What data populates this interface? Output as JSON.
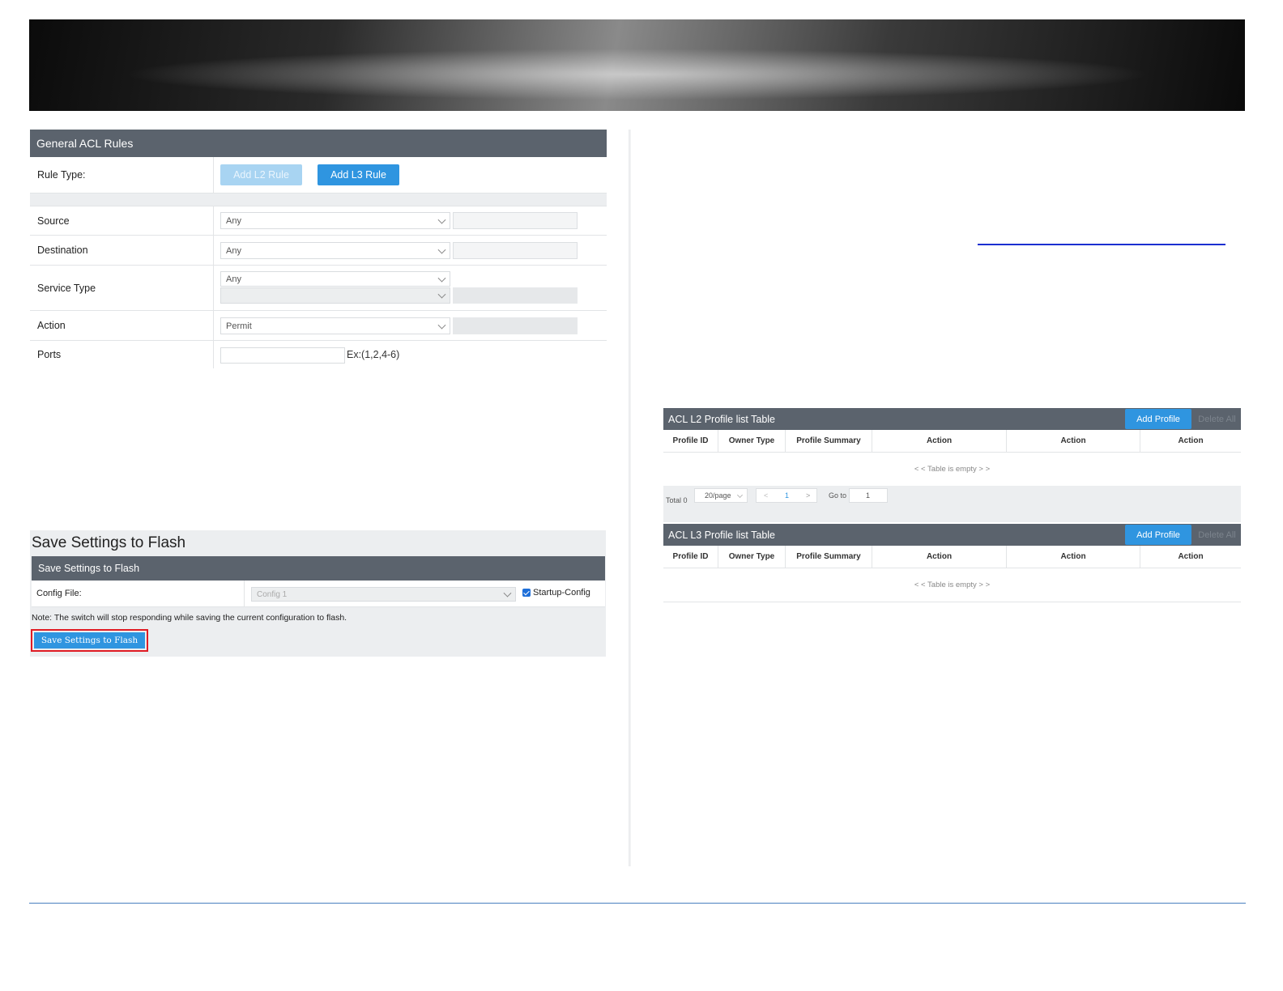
{
  "general_acl": {
    "title": "General ACL Rules",
    "rule_type_label": "Rule Type:",
    "add_l2_label": "Add L2 Rule",
    "add_l3_label": "Add L3 Rule",
    "source_label": "Source",
    "source_value": "Any",
    "destination_label": "Destination",
    "destination_value": "Any",
    "service_type_label": "Service Type",
    "service_type_value": "Any",
    "action_label": "Action",
    "action_value": "Permit",
    "ports_label": "Ports",
    "ports_value": "",
    "ports_hint": "Ex:(1,2,4-6)"
  },
  "save_settings": {
    "page_title": "Save Settings to Flash",
    "panel_title": "Save Settings to Flash",
    "config_file_label": "Config File:",
    "config_file_value": "Config 1",
    "startup_config_label": "Startup-Config",
    "startup_config_checked": true,
    "note": "Note: The switch will stop responding while saving the current configuration to flash.",
    "save_button_label": "Save Settings to Flash"
  },
  "l2_table": {
    "title": "ACL L2 Profile list Table",
    "add_profile_label": "Add Profile",
    "delete_all_label": "Delete All",
    "columns": [
      "Profile ID",
      "Owner Type",
      "Profile Summary",
      "Action",
      "Action",
      "Action"
    ],
    "empty_text": "< < Table is empty > >",
    "pagination": {
      "total": "Total 0",
      "per_page": "20/page",
      "prev": "<",
      "page": "1",
      "next": ">",
      "goto_label": "Go to",
      "goto_value": "1"
    }
  },
  "l3_table": {
    "title": "ACL L3 Profile list Table",
    "add_profile_label": "Add Profile",
    "delete_all_label": "Delete All",
    "columns": [
      "Profile ID",
      "Owner Type",
      "Profile Summary",
      "Action",
      "Action",
      "Action"
    ],
    "empty_text": "< < Table is empty > >"
  },
  "colors": {
    "header_bg": "#5b636d",
    "primary_button": "#2f95e0",
    "primary_button_light": "#a8d4f2",
    "highlight_border": "#e01b24",
    "link_rule": "#1b2fd1",
    "footer_rule": "#4a7fc0"
  }
}
